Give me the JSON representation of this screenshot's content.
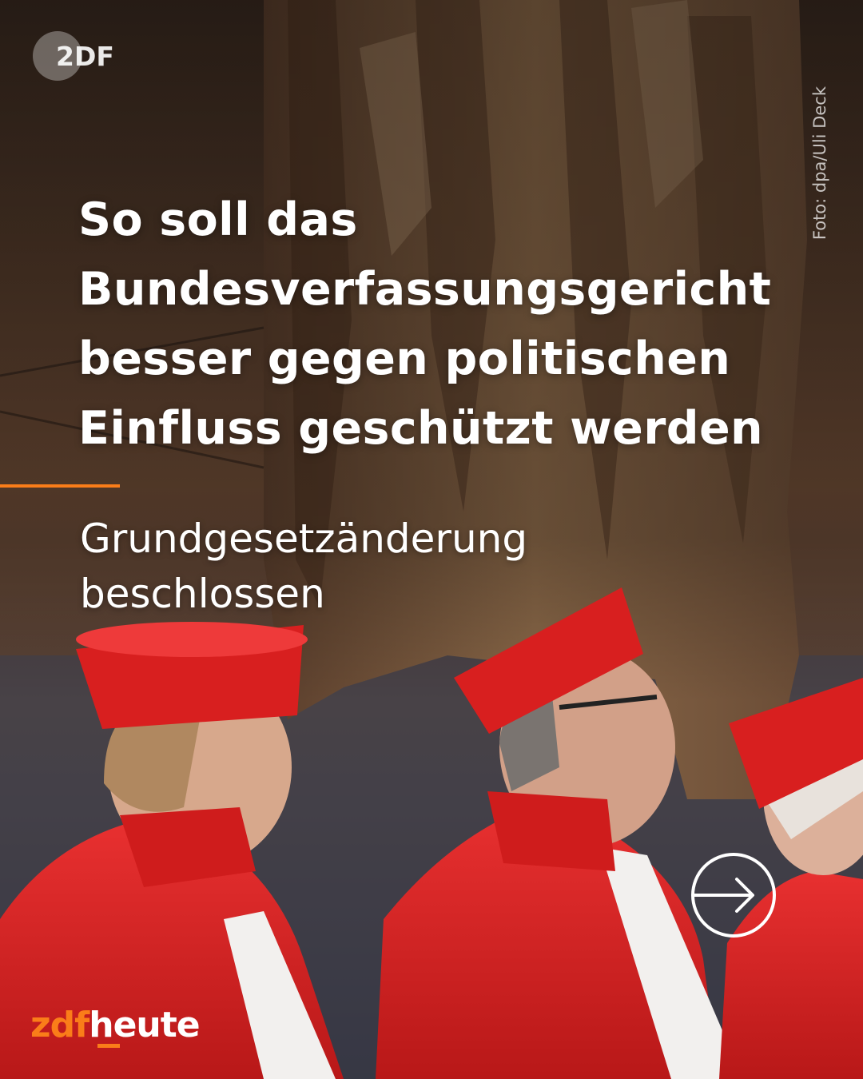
{
  "logo_top": {
    "text": "2DF",
    "icon": "zdf-logo-icon"
  },
  "photo_credit": "Foto: dpa/Uli Deck",
  "headline": {
    "lines": [
      "So soll das",
      "Bundesverfassungsgericht",
      "besser gegen politischen",
      "Einfluss geschützt werden"
    ]
  },
  "subheadline": {
    "lines": [
      "Grundgesetzänderung",
      "beschlossen"
    ]
  },
  "next_button": {
    "icon": "arrow-right-circle-icon"
  },
  "brand": {
    "part1": "zdf",
    "part2": "heute"
  },
  "colors": {
    "accent": "#fa7d19",
    "text": "#ffffff",
    "robe_red": "#d61f1f"
  }
}
